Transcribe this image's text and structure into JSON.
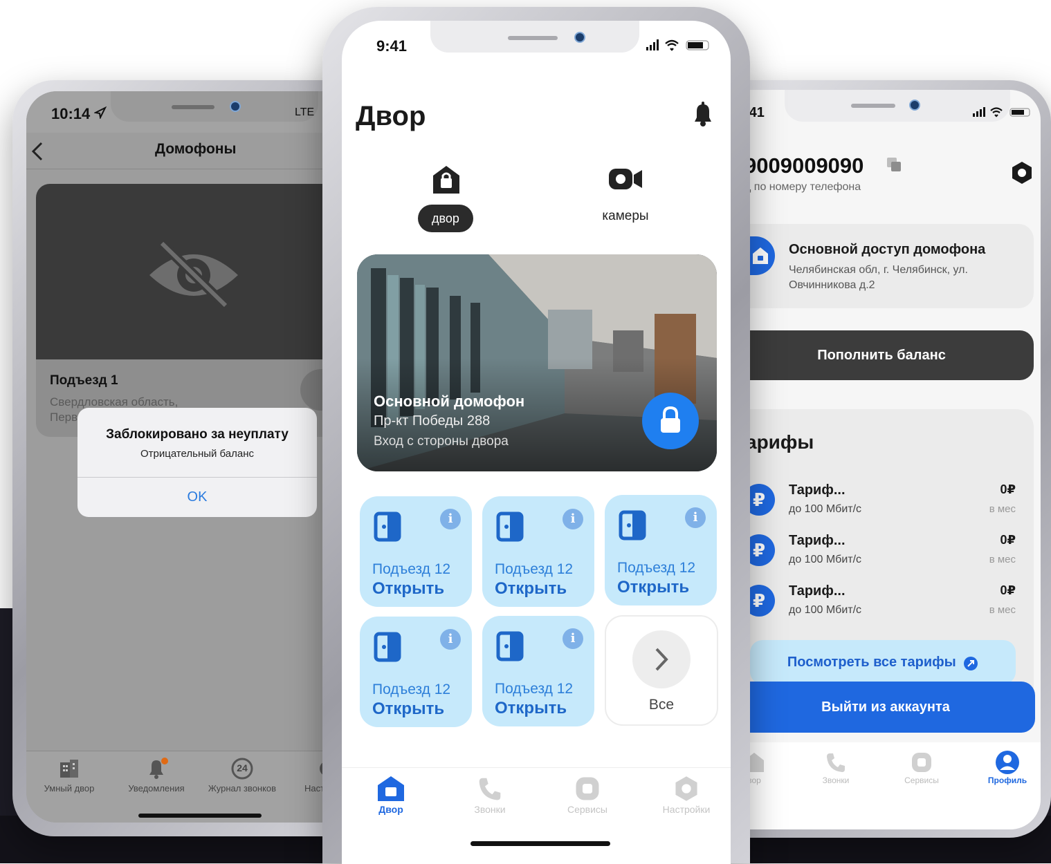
{
  "left_phone": {
    "status_time": "10:14",
    "status_network": "LTE",
    "title": "Домофоны",
    "entrance_title": "Подъезд 1",
    "entrance_address_line1": "Свердловская область,",
    "entrance_address_line2": "Перв",
    "alert_title": "Заблокировано за неуплату",
    "alert_message": "Отрицательный баланс",
    "alert_button": "OK",
    "tabs": [
      {
        "label": "Умный двор",
        "icon": "building-icon"
      },
      {
        "label": "Уведомления",
        "icon": "bell-icon"
      },
      {
        "label": "Журнал звонков",
        "icon": "history-24-icon",
        "badge": "24"
      },
      {
        "label": "Наст",
        "icon": "gear-icon"
      }
    ]
  },
  "center_phone": {
    "status_time": "9:41",
    "header_title": "Двор",
    "segments": [
      {
        "label": "двор",
        "icon": "house-lock-icon",
        "active": true
      },
      {
        "label": "камеры",
        "icon": "video-camera-icon",
        "active": false
      }
    ],
    "main_intercom": {
      "title": "Основной домофон",
      "address": "Пр-кт Победы 288",
      "entrance": "Вход с стороны двора"
    },
    "doors": [
      {
        "name": "Подъезд 12",
        "action": "Открыть"
      },
      {
        "name": "Подъезд 12",
        "action": "Открыть"
      },
      {
        "name": "Подъезд 12",
        "action": "Открыть"
      },
      {
        "name": "Подъезд 12",
        "action": "Открыть"
      },
      {
        "name": "Подъезд 12",
        "action": "Открыть"
      }
    ],
    "all_label": "Все",
    "tabs": [
      {
        "label": "Двор",
        "active": true
      },
      {
        "label": "Звонки",
        "active": false
      },
      {
        "label": "Сервисы",
        "active": false
      },
      {
        "label": "Настройки",
        "active": false
      }
    ],
    "colors": {
      "accent": "#2f80ed",
      "door_tile": "#c6e9fb",
      "door_text": "#1e67c8"
    }
  },
  "right_phone": {
    "status_time": ":41",
    "phone_number": "9009009090",
    "phone_caption": "д по номеру телефона",
    "access_title": "Основной доступ домофона",
    "access_address_line1": "Челябинская обл, г. Челябинск, ул.",
    "access_address_line2": "Овчинникова д.2",
    "topup_button": "Пополнить баланс",
    "tariffs_title": "арифы",
    "tariffs": [
      {
        "name": "Тариф...",
        "speed": "до 100 Мбит/с",
        "price": "0₽",
        "period": "в мес"
      },
      {
        "name": "Тариф...",
        "speed": "до 100 Мбит/с",
        "price": "0₽",
        "period": "в мес"
      },
      {
        "name": "Тариф...",
        "speed": "до 100 Мбит/с",
        "price": "0₽",
        "period": "в мес"
      }
    ],
    "all_tariffs_button": "Посмотреть все тарифы",
    "logout_button": "Выйти из аккаунта",
    "tabs": [
      {
        "label": "вор",
        "active": false
      },
      {
        "label": "Звонки",
        "active": false
      },
      {
        "label": "Сервисы",
        "active": false
      },
      {
        "label": "Профиль",
        "active": true
      }
    ]
  }
}
